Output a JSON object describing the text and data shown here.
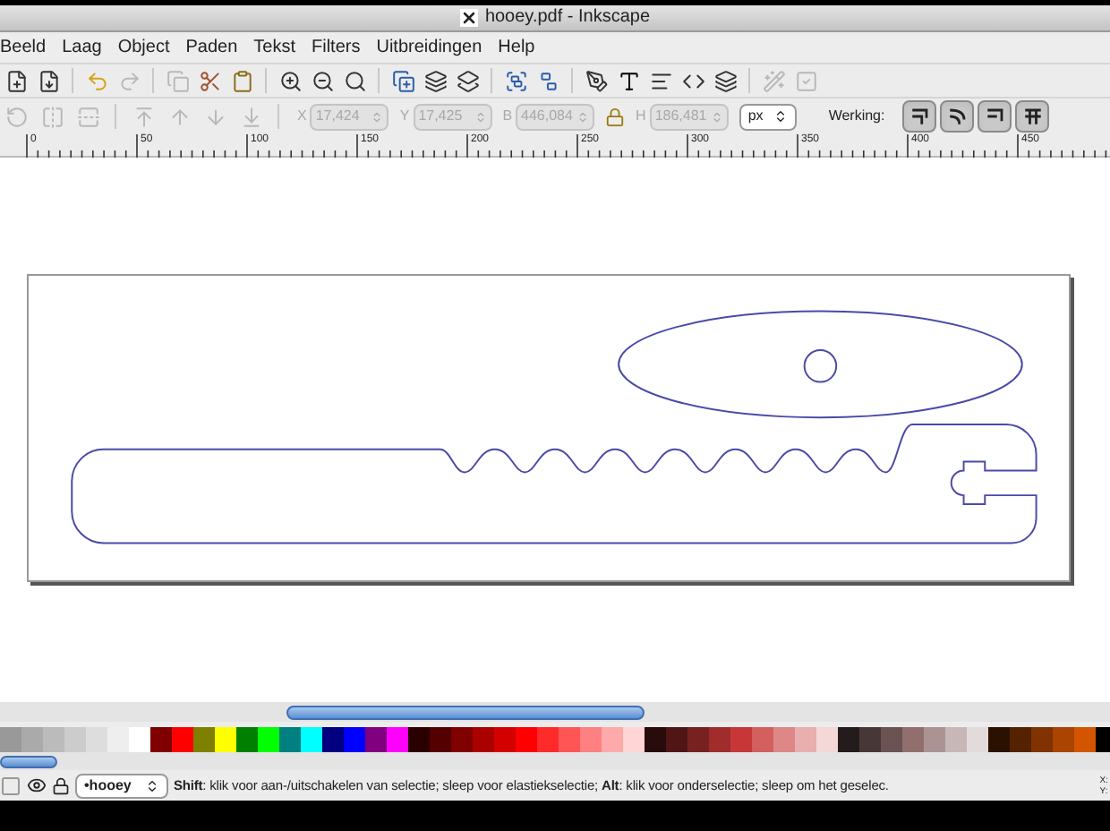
{
  "window": {
    "title": "hooey.pdf - Inkscape"
  },
  "menu": [
    "Beeld",
    "Laag",
    "Object",
    "Paden",
    "Tekst",
    "Filters",
    "Uitbreidingen",
    "Help"
  ],
  "select_toolbar": {
    "fields": [
      {
        "label": "X",
        "value": "17,424",
        "disabled": true
      },
      {
        "label": "Y",
        "value": "17,425",
        "disabled": true
      },
      {
        "label": "B",
        "value": "446,084",
        "disabled": true
      },
      {
        "label": "H",
        "value": "186,481",
        "disabled": true
      }
    ],
    "unit": "px",
    "werking_label": "Werking:",
    "werking_buttons": [
      {
        "on": true
      },
      {
        "on": true
      },
      {
        "on": true
      },
      {
        "on": true
      }
    ]
  },
  "ruler": [
    "0",
    "50",
    "100",
    "150",
    "200",
    "250",
    "300",
    "350",
    "400",
    "450"
  ],
  "palette": [
    {
      "color": "#999999"
    },
    {
      "color": "#aaaaaa"
    },
    {
      "color": "#bbbbbb"
    },
    {
      "color": "#cccccc"
    },
    {
      "color": "#dddddd"
    },
    {
      "color": "#eeeeee"
    },
    {
      "color": "#ffffff"
    },
    {
      "color": "#800000"
    },
    {
      "color": "#ff0000"
    },
    {
      "color": "#808000"
    },
    {
      "color": "#ffff00"
    },
    {
      "color": "#008000"
    },
    {
      "color": "#00ff00"
    },
    {
      "color": "#008080"
    },
    {
      "color": "#00ffff"
    },
    {
      "color": "#000080"
    },
    {
      "color": "#0000ff"
    },
    {
      "color": "#800080"
    },
    {
      "color": "#ff00ff"
    },
    {
      "color": "#2b0000"
    },
    {
      "color": "#550000"
    },
    {
      "color": "#800000"
    },
    {
      "color": "#aa0000"
    },
    {
      "color": "#d40000"
    },
    {
      "color": "#ff0000"
    },
    {
      "color": "#ff2a2a"
    },
    {
      "color": "#ff5555"
    },
    {
      "color": "#ff8080"
    },
    {
      "color": "#ffaaaa"
    },
    {
      "color": "#ffd5d5"
    },
    {
      "color": "#280b0b"
    },
    {
      "color": "#501616"
    },
    {
      "color": "#782121"
    },
    {
      "color": "#a02c2c"
    },
    {
      "color": "#c83737"
    },
    {
      "color": "#d35f5f"
    },
    {
      "color": "#de8787"
    },
    {
      "color": "#e9afaf"
    },
    {
      "color": "#f4d7d7"
    },
    {
      "color": "#241c1c"
    },
    {
      "color": "#483737"
    },
    {
      "color": "#6c5353"
    },
    {
      "color": "#916f6f"
    },
    {
      "color": "#ac9393"
    },
    {
      "color": "#c8b7b7"
    },
    {
      "color": "#e3dbdb"
    },
    {
      "color": "#2b1100"
    },
    {
      "color": "#552200"
    },
    {
      "color": "#803300"
    },
    {
      "color": "#aa4400"
    },
    {
      "color": "#d45500"
    }
  ],
  "status_bar": {
    "layer": "•hooey",
    "message": "**Shift**: klik voor aan-/uitschakelen van selectie; sleep voor elastiekselectie; **Alt**: klik voor onderselectie; sleep om het geselec.",
    "coords": [
      "X:",
      "Y:"
    ]
  }
}
